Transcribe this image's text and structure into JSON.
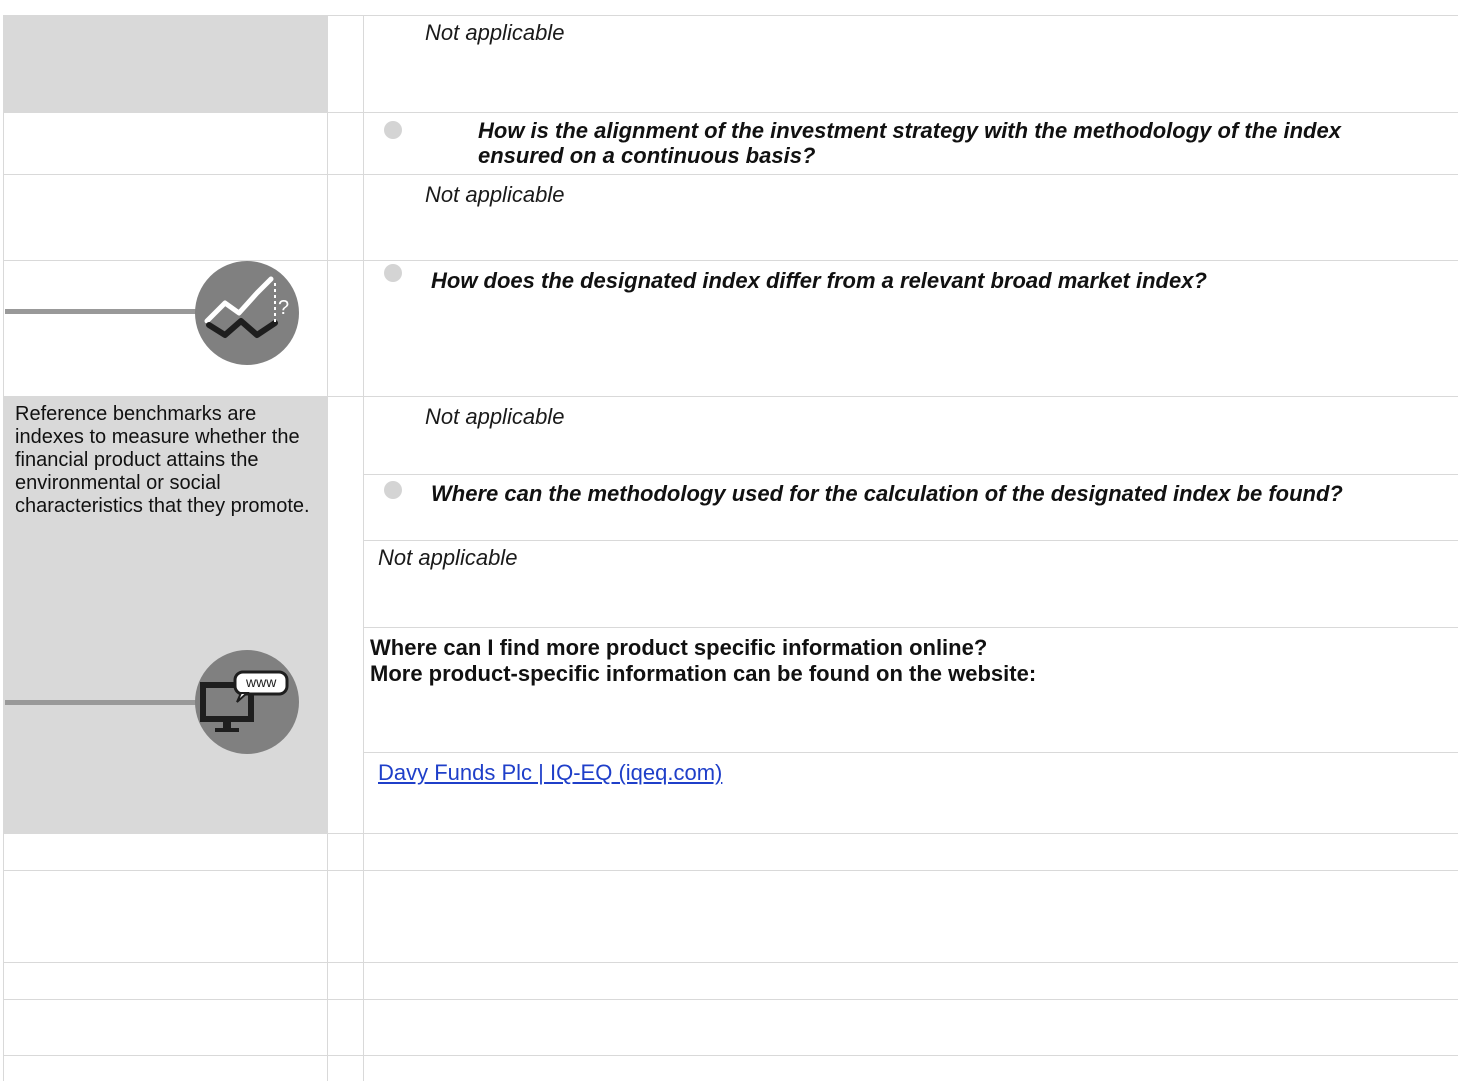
{
  "rows": {
    "not_applicable_1": "Not applicable",
    "question_alignment": "How is the alignment of the investment strategy with the methodology of the index ensured on a continuous basis?",
    "not_applicable_2": "Not applicable",
    "question_difference": "How does the designated index differ from a relevant broad market index?",
    "not_applicable_3": "Not applicable",
    "question_methodology": "Where can the methodology used for the calculation of the designated index be found?",
    "not_applicable_4": "Not applicable"
  },
  "sidebar": {
    "definition": "Reference benchmarks are indexes to measure whether the financial product attains the environmental or social characteristics that they promote."
  },
  "online": {
    "heading": "Where can I find more product specific information online?",
    "body": "More product-specific information can be found on the website:",
    "link_text": "Davy Funds Plc | IQ-EQ (iqeq.com)"
  },
  "icons": {
    "chart_icon": "chart-question-icon",
    "chart_glyph": "?",
    "web_icon": "computer-www-icon",
    "web_glyph": "www"
  },
  "colors": {
    "sidebar_bg": "#d9d9d9",
    "icon_circle": "#808080",
    "link": "#1f3fc9"
  }
}
